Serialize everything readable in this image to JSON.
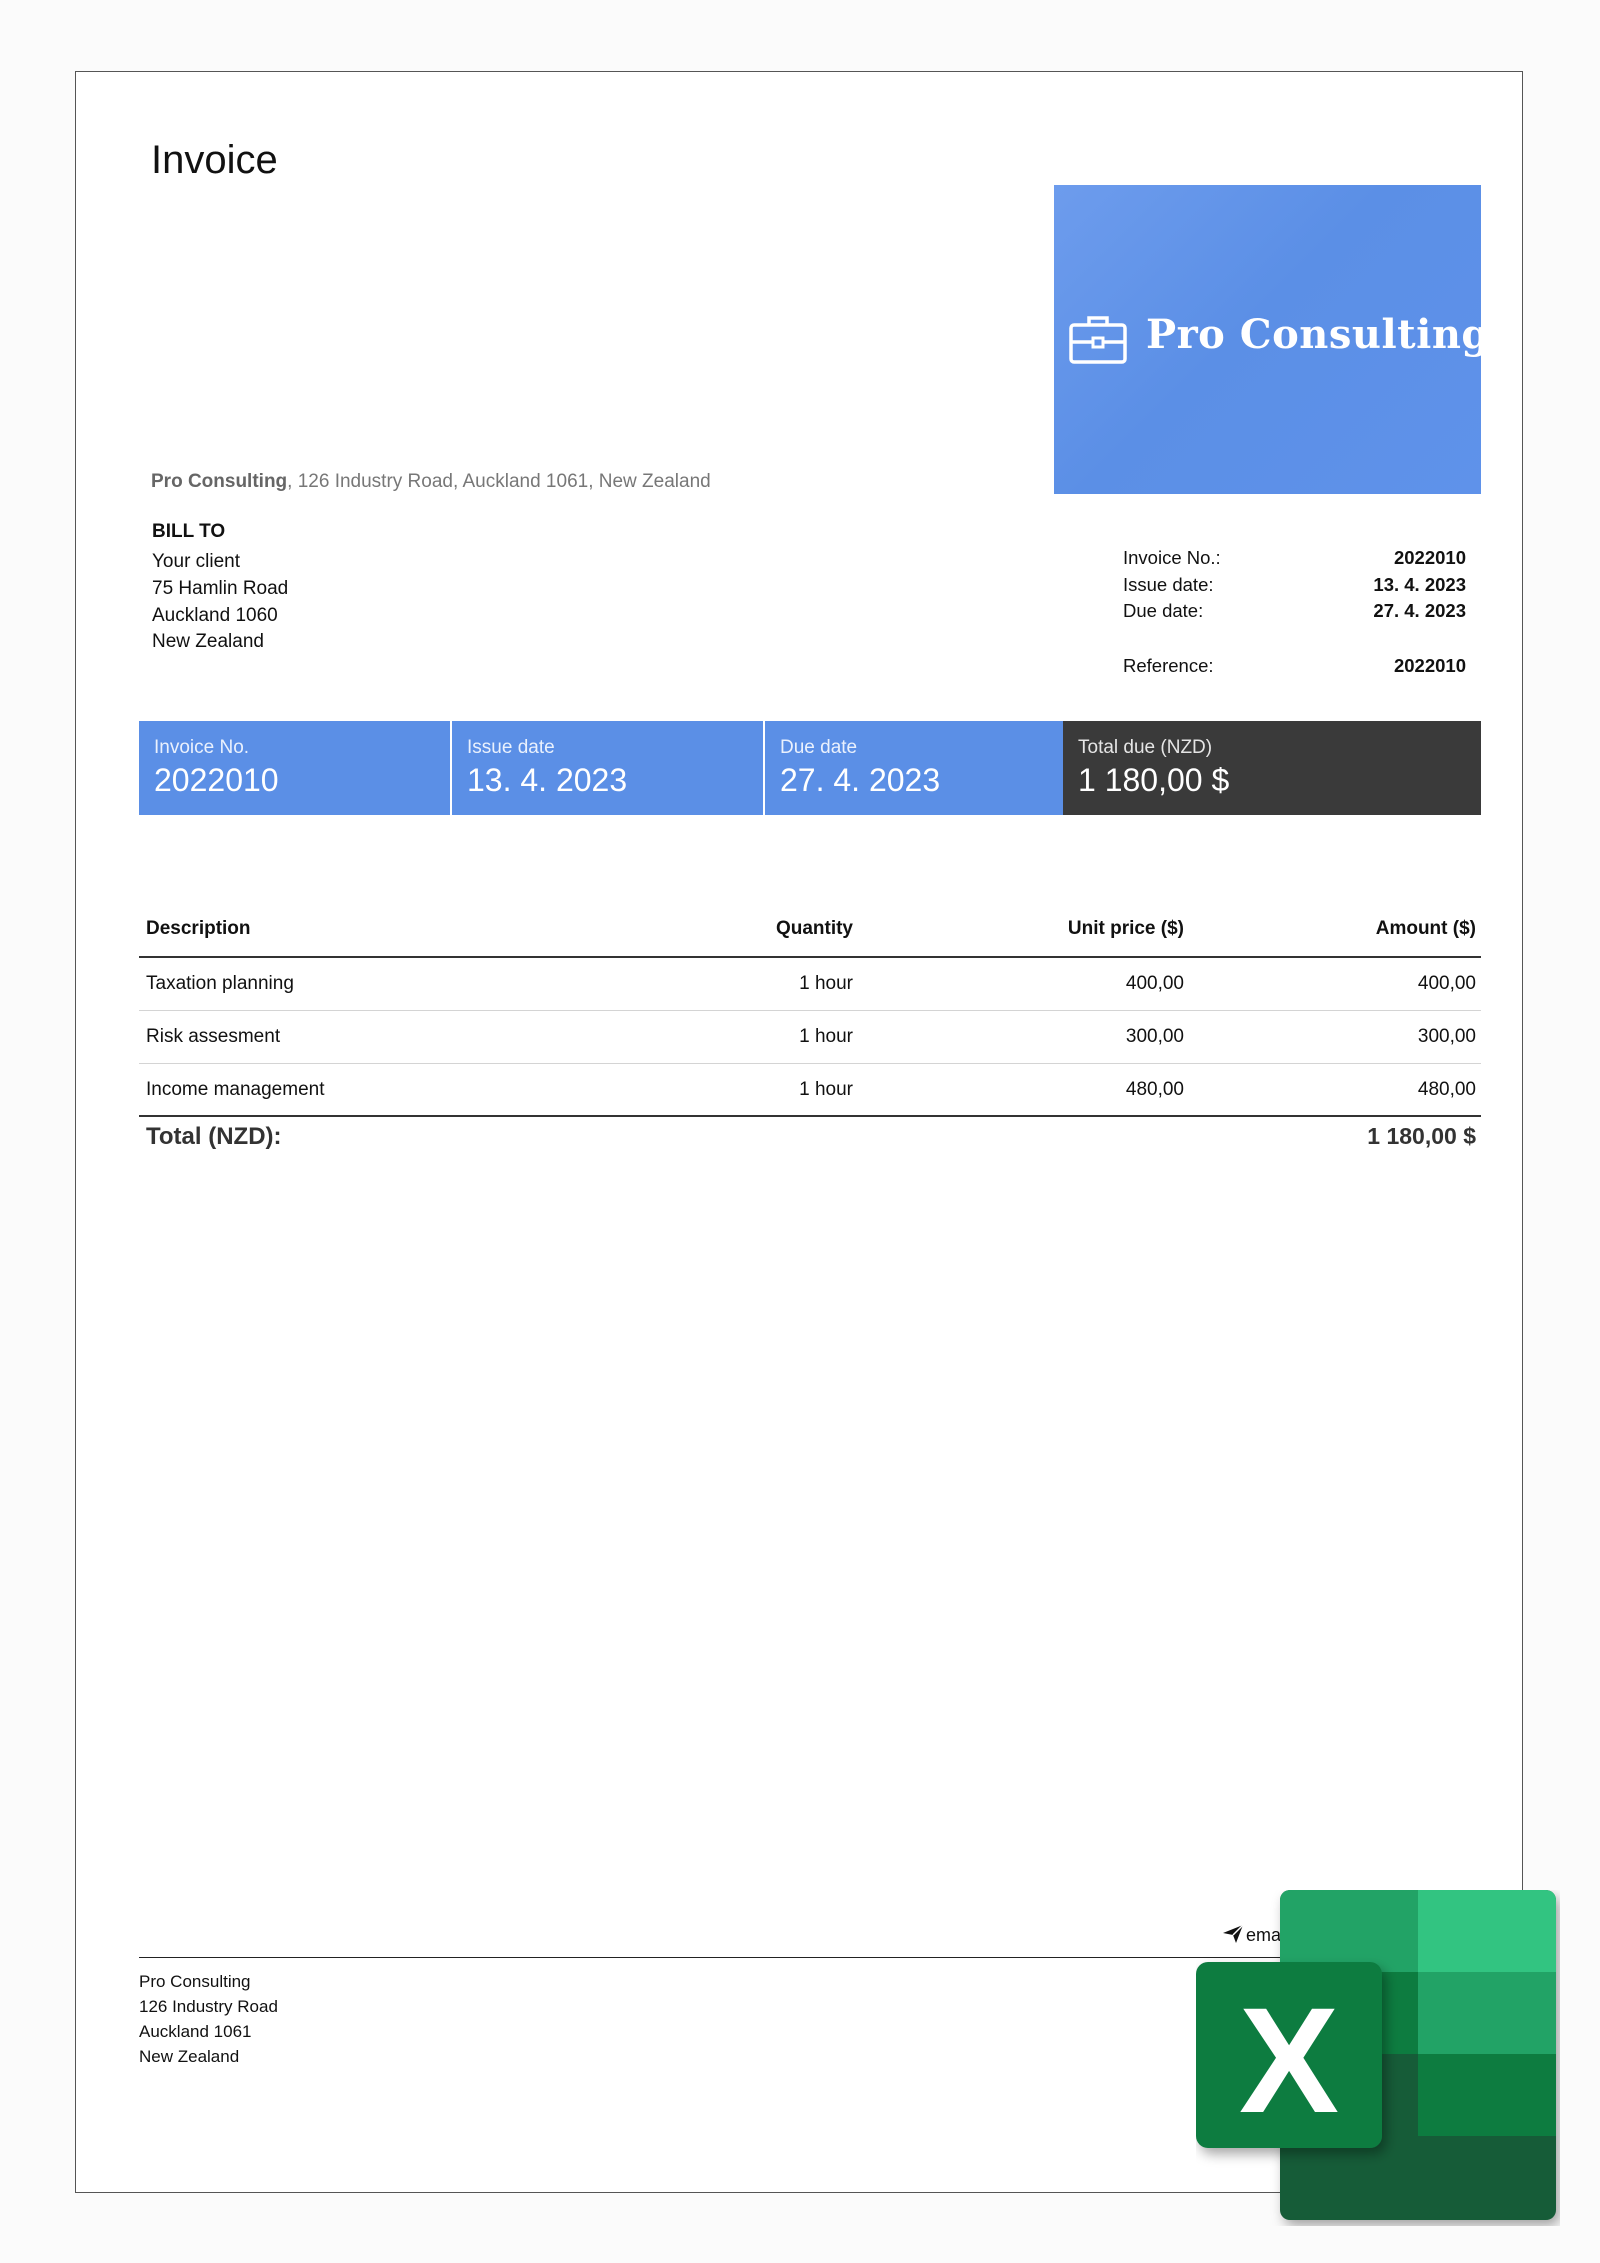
{
  "invoice": {
    "title": "Invoice",
    "logo_text": "Pro Consulting",
    "sender_name": "Pro Consulting",
    "sender_address": ", 126 Industry Road, Auckland 1061, New Zealand",
    "bill_to": {
      "heading": "BILL TO",
      "lines": [
        "Your client",
        "75 Hamlin Road",
        "Auckland 1060",
        "New Zealand"
      ]
    },
    "meta": {
      "invoice_no_label": "Invoice No.:",
      "invoice_no": "2022010",
      "issue_date_label": "Issue date:",
      "issue_date": "13. 4. 2023",
      "due_date_label": "Due date:",
      "due_date": "27. 4. 2023",
      "reference_label": "Reference:",
      "reference": "2022010"
    },
    "summary": {
      "invoice_no_label": "Invoice No.",
      "invoice_no": "2022010",
      "issue_date_label": "Issue date",
      "issue_date": "13. 4. 2023",
      "due_date_label": "Due date",
      "due_date": "27. 4. 2023",
      "total_label": "Total due (NZD)",
      "total": "1 180,00 $"
    },
    "table": {
      "headers": {
        "description": "Description",
        "quantity": "Quantity",
        "unit_price": "Unit price ($)",
        "amount": "Amount ($)"
      },
      "rows": [
        {
          "description": "Taxation planning",
          "quantity": "1 hour",
          "unit_price": "400,00",
          "amount": "400,00"
        },
        {
          "description": "Risk assesment",
          "quantity": "1 hour",
          "unit_price": "300,00",
          "amount": "300,00"
        },
        {
          "description": "Income management",
          "quantity": "1 hour",
          "unit_price": "480,00",
          "amount": "480,00"
        }
      ],
      "total_label": "Total (NZD):",
      "total_value": "1 180,00 $"
    },
    "footer": {
      "lines": [
        "Pro Consulting",
        "126 Industry Road",
        "Auckland 1061",
        "New Zealand"
      ],
      "email_partial": "ema"
    }
  },
  "overlay": {
    "excel_letter": "X",
    "excel_colors": [
      "#21a366",
      "#33c481",
      "#107c41",
      "#185c37"
    ]
  },
  "colors": {
    "accent_blue": "#5b8fe6",
    "dark_cell": "#3a3a3a"
  }
}
